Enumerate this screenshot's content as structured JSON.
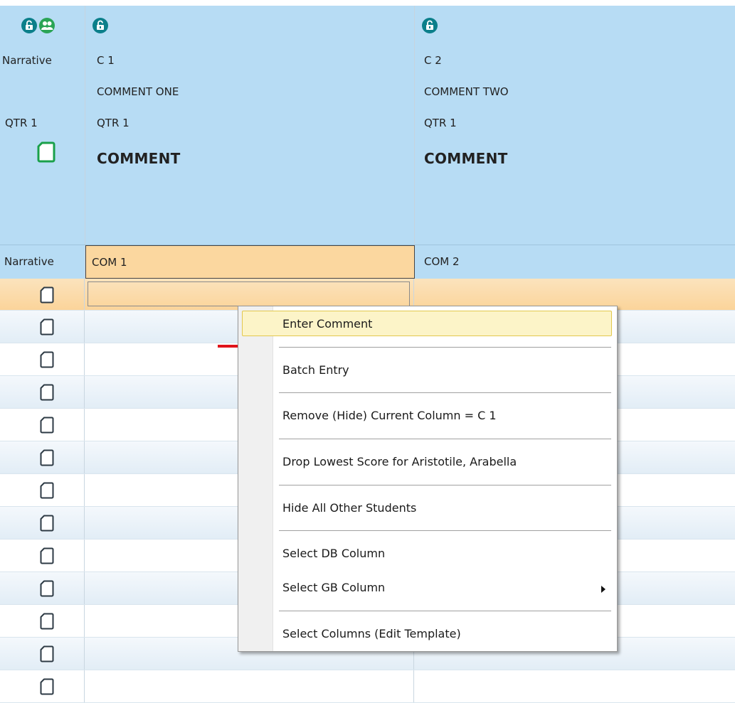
{
  "header": {
    "narrative": {
      "title": "Narrative",
      "term": "QTR 1",
      "lock_icon": "lock-open-icon",
      "group_icon": "people-icon",
      "doc_icon": "document-icon"
    },
    "columns": [
      {
        "code": "C 1",
        "description": "COMMENT ONE",
        "term": "QTR 1",
        "type": "COMMENT",
        "lock_icon": "lock-open-icon"
      },
      {
        "code": "C 2",
        "description": "COMMENT TWO",
        "term": "QTR 1",
        "type": "COMMENT",
        "lock_icon": "lock-open-icon"
      }
    ]
  },
  "subheader": {
    "narrative": "Narrative",
    "col1": "COM 1",
    "col2": "COM 2"
  },
  "grid": {
    "row_icon": "document-icon",
    "row_count": 13,
    "selected_row": 0
  },
  "context_menu": {
    "items": [
      {
        "label": "Enter Comment",
        "highlighted": true
      },
      {
        "label": "Batch Entry"
      },
      {
        "label": "Remove (Hide) Current Column = C 1"
      },
      {
        "label": "Drop Lowest Score for Aristotile, Arabella"
      },
      {
        "label": "Hide All Other Students"
      },
      {
        "label": "Select DB Column"
      },
      {
        "label": "Select GB Column",
        "submenu": true
      },
      {
        "label": "Select Columns (Edit Template)"
      }
    ]
  },
  "colors": {
    "header_bg": "#b7dcf4",
    "selected_cell": "#fbd79f",
    "menu_highlight": "#fcf4c8",
    "annotation_red": "#e0141b"
  }
}
